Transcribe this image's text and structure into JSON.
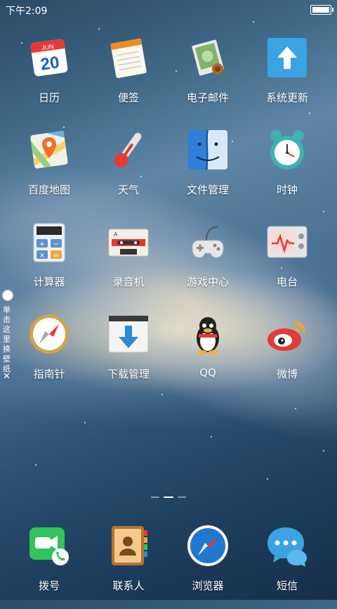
{
  "status_bar": {
    "time": "下午2:09"
  },
  "apps": [
    {
      "label": "日历",
      "icon": "calendar-icon",
      "month": "JUN",
      "day": "20"
    },
    {
      "label": "便签",
      "icon": "notes-icon"
    },
    {
      "label": "电子邮件",
      "icon": "mail-icon"
    },
    {
      "label": "系统更新",
      "icon": "system-update-icon"
    },
    {
      "label": "百度地图",
      "icon": "baidu-map-icon"
    },
    {
      "label": "天气",
      "icon": "weather-thermometer-icon"
    },
    {
      "label": "文件管理",
      "icon": "file-manager-icon"
    },
    {
      "label": "时钟",
      "icon": "clock-icon"
    },
    {
      "label": "计算器",
      "icon": "calculator-icon"
    },
    {
      "label": "录音机",
      "icon": "recorder-cassette-icon",
      "cassette_letter": "A"
    },
    {
      "label": "游戏中心",
      "icon": "game-center-controller-icon"
    },
    {
      "label": "电台",
      "icon": "radio-icon"
    },
    {
      "label": "指南针",
      "icon": "compass-icon"
    },
    {
      "label": "下载管理",
      "icon": "download-manager-icon"
    },
    {
      "label": "QQ",
      "icon": "qq-penguin-icon"
    },
    {
      "label": "微博",
      "icon": "weibo-icon"
    }
  ],
  "side_tab": {
    "text": "单击这里换壁纸",
    "close": "✕"
  },
  "page_indicator": {
    "count": 3,
    "active": 1
  },
  "dock": [
    {
      "label": "拨号",
      "icon": "phone-dialer-icon"
    },
    {
      "label": "联系人",
      "icon": "contacts-icon"
    },
    {
      "label": "浏览器",
      "icon": "browser-compass-icon"
    },
    {
      "label": "短信",
      "icon": "messages-icon"
    }
  ]
}
